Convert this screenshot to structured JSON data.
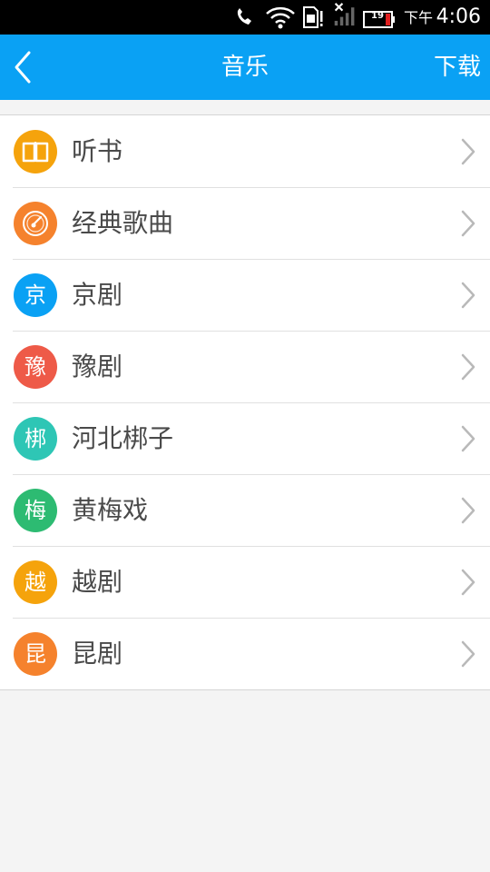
{
  "status_bar": {
    "battery_level": "19",
    "ampm": "下午",
    "time": "4:06"
  },
  "header": {
    "title": "音乐",
    "download_label": "下载"
  },
  "list": {
    "items": [
      {
        "label": "听书",
        "icon_char": "",
        "icon_name": "book-icon",
        "color": "#f5a30c"
      },
      {
        "label": "经典歌曲",
        "icon_char": "",
        "icon_name": "compass-icon",
        "color": "#f5822d"
      },
      {
        "label": "京剧",
        "icon_char": "京",
        "icon_name": "jing-icon",
        "color": "#0aa1f4"
      },
      {
        "label": "豫剧",
        "icon_char": "豫",
        "icon_name": "yu-icon",
        "color": "#ee5a48"
      },
      {
        "label": "河北梆子",
        "icon_char": "梆",
        "icon_name": "bang-icon",
        "color": "#2ec6b5"
      },
      {
        "label": "黄梅戏",
        "icon_char": "梅",
        "icon_name": "mei-icon",
        "color": "#2dbb72"
      },
      {
        "label": "越剧",
        "icon_char": "越",
        "icon_name": "yue-icon",
        "color": "#f5a30c"
      },
      {
        "label": "昆剧",
        "icon_char": "昆",
        "icon_name": "kun-icon",
        "color": "#f5822d"
      }
    ]
  }
}
